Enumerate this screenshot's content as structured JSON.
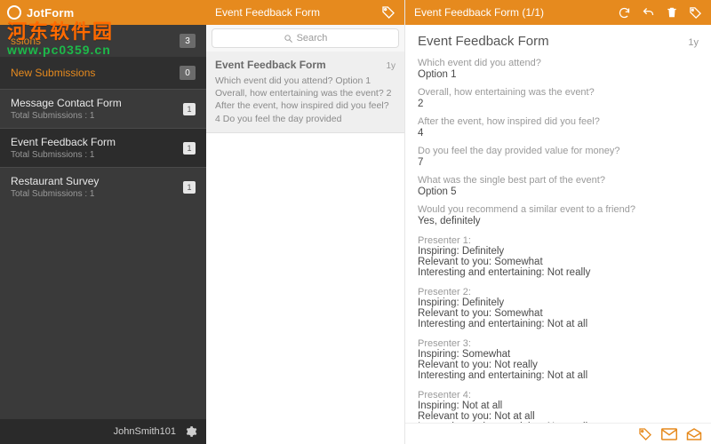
{
  "brand": {
    "name": "JotForm"
  },
  "watermark": {
    "line1": "河东软件园",
    "line2": "www.pc0359.cn"
  },
  "sidebar": {
    "tags": [
      {
        "label": "ssions",
        "count": "3"
      },
      {
        "label": "New Submissions",
        "count": "0"
      }
    ],
    "forms": [
      {
        "name": "Message Contact Form",
        "sub": "Total Submissions : 1",
        "badge": "1"
      },
      {
        "name": "Event Feedback Form",
        "sub": "Total Submissions : 1",
        "badge": "1"
      },
      {
        "name": "Restaurant Survey",
        "sub": "Total Submissions : 1",
        "badge": "1"
      }
    ],
    "footer": {
      "username": "JohnSmith101"
    }
  },
  "mid": {
    "title": "Event Feedback Form",
    "search_placeholder": "Search",
    "item": {
      "title": "Event Feedback Form",
      "age": "1y",
      "preview": "Which  event did you attend? Option 1  Overall, how entertaining was the event?  2  After the event, how inspired did you feel? 4  Do you feel the day provided"
    }
  },
  "detail": {
    "topbar_title": "Event Feedback Form (1/1)",
    "title": "Event Feedback Form",
    "age": "1y",
    "qa": [
      {
        "q": "Which  event did you attend?",
        "a": "Option 1"
      },
      {
        "q": "Overall, how entertaining was the event?",
        "a": "2"
      },
      {
        "q": "After the event, how inspired did you feel?",
        "a": "4"
      },
      {
        "q": "Do you feel the day provided value for money?",
        "a": "7"
      },
      {
        "q": "What was the single best part of the event?",
        "a": "Option 5"
      },
      {
        "q": "Would you recommend a similar event to a friend?",
        "a": "Yes, definitely"
      }
    ],
    "presenters": [
      {
        "head": "Presenter 1:",
        "lines": [
          "Inspiring: Definitely",
          "Relevant to you: Somewhat",
          "Interesting and entertaining: Not really"
        ]
      },
      {
        "head": "Presenter 2:",
        "lines": [
          "Inspiring: Definitely",
          "Relevant to you: Somewhat",
          "Interesting and entertaining: Not at all"
        ]
      },
      {
        "head": "Presenter 3:",
        "lines": [
          "Inspiring: Somewhat",
          "Relevant to you: Not really",
          "Interesting and entertaining: Not at all"
        ]
      },
      {
        "head": "Presenter 4:",
        "lines": [
          "Inspiring: Not at all",
          "Relevant to you: Not at all",
          "Interesting and entertaining: Not at all"
        ]
      }
    ]
  }
}
